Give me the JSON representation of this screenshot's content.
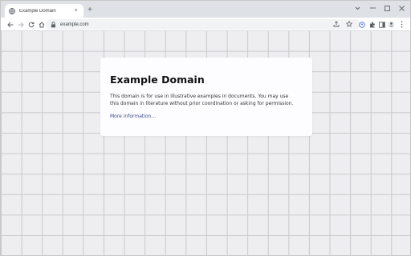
{
  "tab": {
    "title": "Example Domain",
    "close_glyph": "×"
  },
  "newtab_glyph": "+",
  "window_controls": {
    "dropdown": "⌄",
    "minimize": "–",
    "maximize": "☐",
    "close": "✕"
  },
  "omnibox": {
    "url": "example.com"
  },
  "page": {
    "heading": "Example Domain",
    "body": "This domain is for use in illustrative examples in documents. You may use this domain in literature without prior coordination or asking for permission.",
    "link": "More information..."
  },
  "icons": {
    "favicon": "globe-icon",
    "back": "back-arrow-icon",
    "forward": "forward-arrow-icon",
    "reload": "reload-icon",
    "home": "home-icon",
    "lock": "lock-icon",
    "share": "share-icon",
    "bookmark": "star-icon",
    "profile_badge": "profile-badge-icon",
    "extensions": "puzzle-icon",
    "sidepanel": "side-panel-icon",
    "account": "account-icon",
    "menu": "kebab-menu-icon"
  },
  "colors": {
    "page_bg": "#eeeef0",
    "card_bg": "#fdfdff",
    "link": "#38488f",
    "tabstrip": "#dee1e6"
  }
}
